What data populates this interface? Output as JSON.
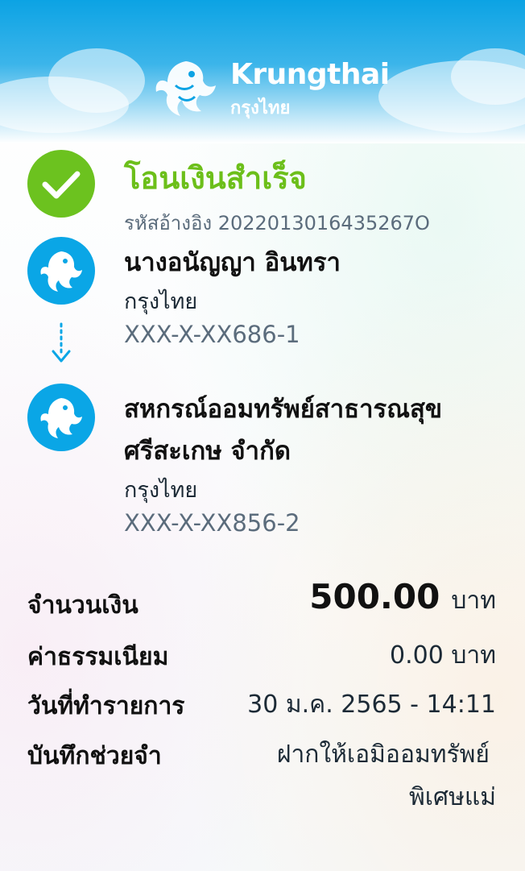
{
  "header": {
    "brand_en": "Krungthai",
    "brand_th": "กรุงไทย",
    "logo_icon": "krungthai-phoenix-icon"
  },
  "status": {
    "title": "โอนเงินสำเร็จ",
    "reference": "รหัสอ้างอิง 2022013016435267O",
    "icon": "check-circle-icon",
    "color": "#6cc21f"
  },
  "sender": {
    "name": "นางอนัญญา อินทรา",
    "bank": "กรุงไทย",
    "account": "XXX-X-XX686-1"
  },
  "receiver": {
    "name_line1": "สหกรณ์ออมทรัพย์สาธารณสุข",
    "name_line2": "ศรีสะเกษ จำกัด",
    "bank": "กรุงไทย",
    "account": "XXX-X-XX856-2"
  },
  "details": {
    "amount_label": "จำนวนเงิน",
    "amount_value": "500.00",
    "amount_unit": "บาท",
    "fee_label": "ค่าธรรมเนียม",
    "fee_value": "0.00 บาท",
    "date_label": "วันที่ทำรายการ",
    "date_value": "30 ม.ค. 2565 - 14:11",
    "memo_label": "บันทึกช่วยจำ",
    "memo_line1": "ฝากให้เอมิออมทรัพย์",
    "memo_line2": "พิเศษแม่"
  },
  "colors": {
    "brand_blue": "#0aa6e6",
    "success_green": "#6cc21f"
  }
}
